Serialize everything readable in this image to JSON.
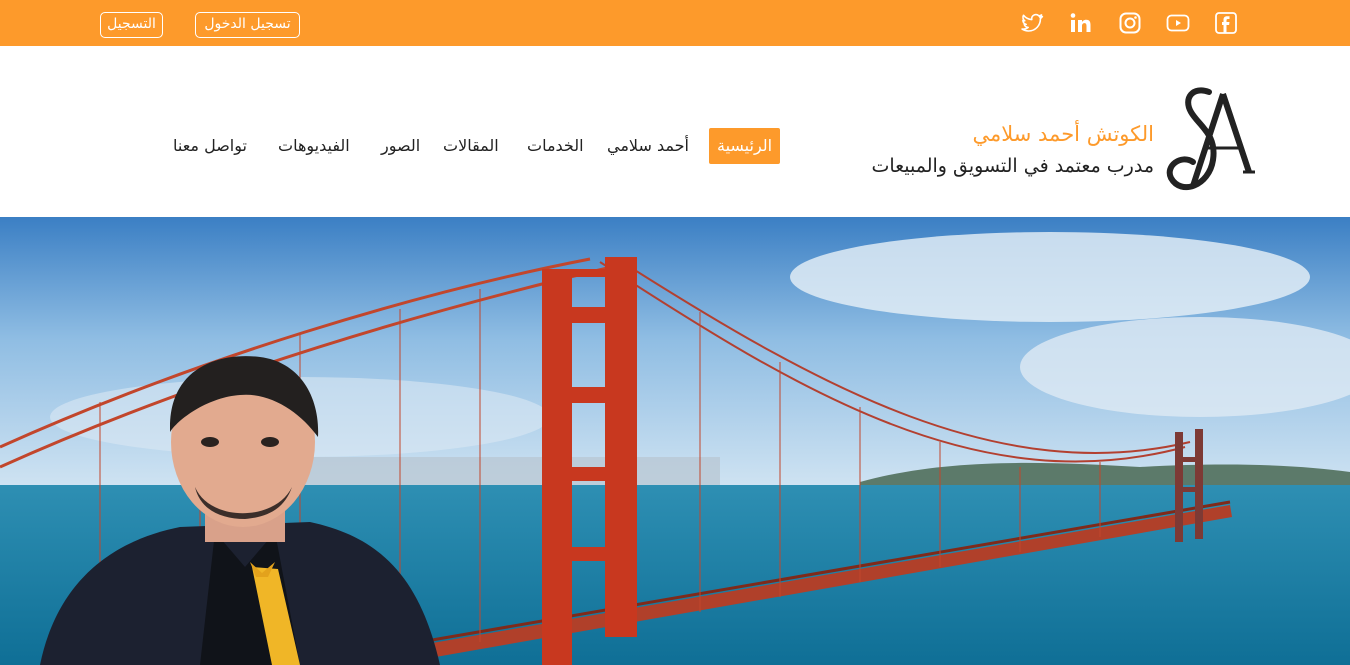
{
  "topbar": {
    "register_label": "التسجيل",
    "login_label": "تسجيل الدخول",
    "social_icons": [
      "twitter-icon",
      "linkedin-icon",
      "instagram-icon",
      "youtube-icon",
      "facebook-icon"
    ]
  },
  "brand": {
    "title": "الكوتش أحمد سلامي",
    "subtitle": "مدرب معتمد في التسويق والمبيعات",
    "logo_letters": "SA"
  },
  "nav": {
    "items": [
      "الرئيسية",
      "أحمد سلامي",
      "الخدمات",
      "المقالات",
      "الصور",
      "الفيديوهات",
      "تواصل معنا"
    ],
    "active": "الرئيسية"
  },
  "colors": {
    "accent": "#fd9a2b",
    "text": "#222222",
    "white": "#ffffff"
  }
}
